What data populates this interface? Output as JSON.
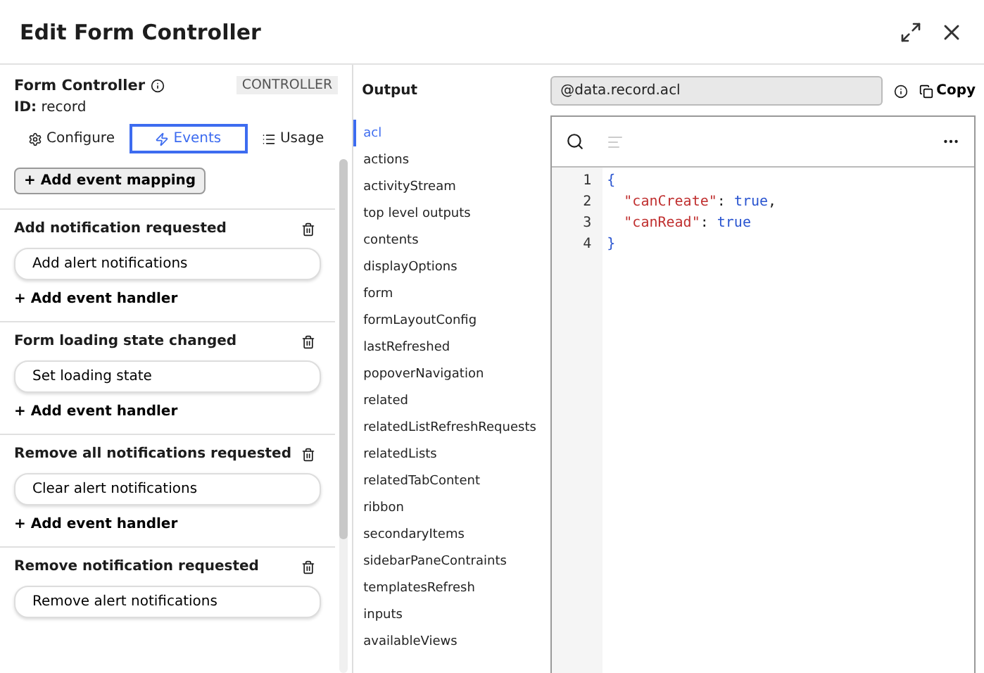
{
  "window": {
    "title": "Edit Form Controller"
  },
  "controller": {
    "name": "Form Controller",
    "badge": "CONTROLLER",
    "id_label": "ID:",
    "id_value": "record"
  },
  "tabs": [
    {
      "label": "Configure",
      "selected": false
    },
    {
      "label": "Events",
      "selected": true
    },
    {
      "label": "Usage",
      "selected": false
    }
  ],
  "add_mapping": "+ Add event mapping",
  "events": [
    {
      "title": "Add notification requested",
      "handler": "Add alert notifications",
      "add": "+ Add event handler"
    },
    {
      "title": "Form loading state changed",
      "handler": "Set loading state",
      "add": "+ Add event handler"
    },
    {
      "title": "Remove all notifications requested",
      "handler": "Clear alert notifications",
      "add": "+ Add event handler"
    },
    {
      "title": "Remove notification requested",
      "handler": "Remove alert notifications"
    }
  ],
  "output": {
    "label": "Output",
    "path": "@data.record.acl",
    "copy": "Copy"
  },
  "outputs": [
    {
      "label": "acl",
      "selected": true
    },
    {
      "label": "actions",
      "selected": false
    },
    {
      "label": "activityStream",
      "selected": false
    },
    {
      "label": "top level outputs",
      "selected": false
    },
    {
      "label": "contents",
      "selected": false
    },
    {
      "label": "displayOptions",
      "selected": false
    },
    {
      "label": "form",
      "selected": false
    },
    {
      "label": "formLayoutConfig",
      "selected": false
    },
    {
      "label": "lastRefreshed",
      "selected": false
    },
    {
      "label": "popoverNavigation",
      "selected": false
    },
    {
      "label": "related",
      "selected": false
    },
    {
      "label": "relatedListRefreshRequests",
      "selected": false
    },
    {
      "label": "relatedLists",
      "selected": false
    },
    {
      "label": "relatedTabContent",
      "selected": false
    },
    {
      "label": "ribbon",
      "selected": false
    },
    {
      "label": "secondaryItems",
      "selected": false
    },
    {
      "label": "sidebarPaneContraints",
      "selected": false
    },
    {
      "label": "templatesRefresh",
      "selected": false
    },
    {
      "label": "inputs",
      "selected": false
    },
    {
      "label": "availableViews",
      "selected": false
    }
  ],
  "code": [
    {
      "number": "1",
      "tokens": [
        {
          "kind": "punct",
          "text": "{"
        }
      ]
    },
    {
      "number": "2",
      "tokens": [
        {
          "kind": "key",
          "text": "  \"canCreate\""
        },
        {
          "kind": "plain",
          "text": ": "
        },
        {
          "kind": "bool",
          "text": "true"
        },
        {
          "kind": "plain",
          "text": ","
        }
      ]
    },
    {
      "number": "3",
      "tokens": [
        {
          "kind": "key",
          "text": "  \"canRead\""
        },
        {
          "kind": "plain",
          "text": ": "
        },
        {
          "kind": "bool",
          "text": "true"
        }
      ]
    },
    {
      "number": "4",
      "tokens": [
        {
          "kind": "punct",
          "text": "}"
        }
      ]
    }
  ]
}
